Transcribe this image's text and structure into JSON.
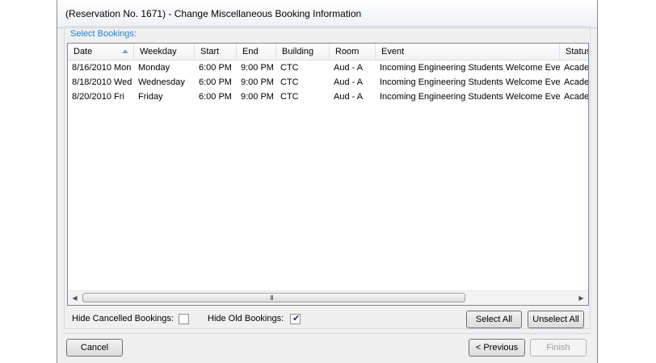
{
  "window": {
    "title": "(Reservation No. 1671) - Change Miscellaneous Booking Information"
  },
  "group": {
    "label": "Select Bookings:"
  },
  "grid": {
    "columns": [
      "Date",
      "Weekday",
      "Start",
      "End",
      "Building",
      "Room",
      "Event",
      "Status"
    ],
    "rows": [
      {
        "date": "8/16/2010 Mon",
        "weekday": "Monday",
        "start": "6:00 PM",
        "end": "9:00 PM",
        "building": "CTC",
        "room": "Aud - A",
        "event": "Incoming Engineering Students Welcome Events",
        "status": "Academic"
      },
      {
        "date": "8/18/2010 Wed",
        "weekday": "Wednesday",
        "start": "6:00 PM",
        "end": "9:00 PM",
        "building": "CTC",
        "room": "Aud - A",
        "event": "Incoming Engineering Students Welcome Events",
        "status": "Academic"
      },
      {
        "date": "8/20/2010 Fri",
        "weekday": "Friday",
        "start": "6:00 PM",
        "end": "9:00 PM",
        "building": "CTC",
        "room": "Aud - A",
        "event": "Incoming Engineering Students Welcome Events",
        "status": "Academic"
      }
    ],
    "scroll_grip": "III"
  },
  "options": {
    "hide_cancelled_label": "Hide Cancelled Bookings:",
    "hide_cancelled_checked": false,
    "hide_old_label": "Hide Old Bookings:",
    "hide_old_checked": true
  },
  "buttons": {
    "select_all": "Select All",
    "unselect_all": "Unselect All",
    "cancel": "Cancel",
    "previous": "< Previous",
    "finish": "Finish"
  },
  "icons": {
    "sort": "sort-ascending-icon",
    "scroll_left": "scroll-left-icon",
    "scroll_right": "scroll-right-icon",
    "check": "checkmark-icon"
  }
}
